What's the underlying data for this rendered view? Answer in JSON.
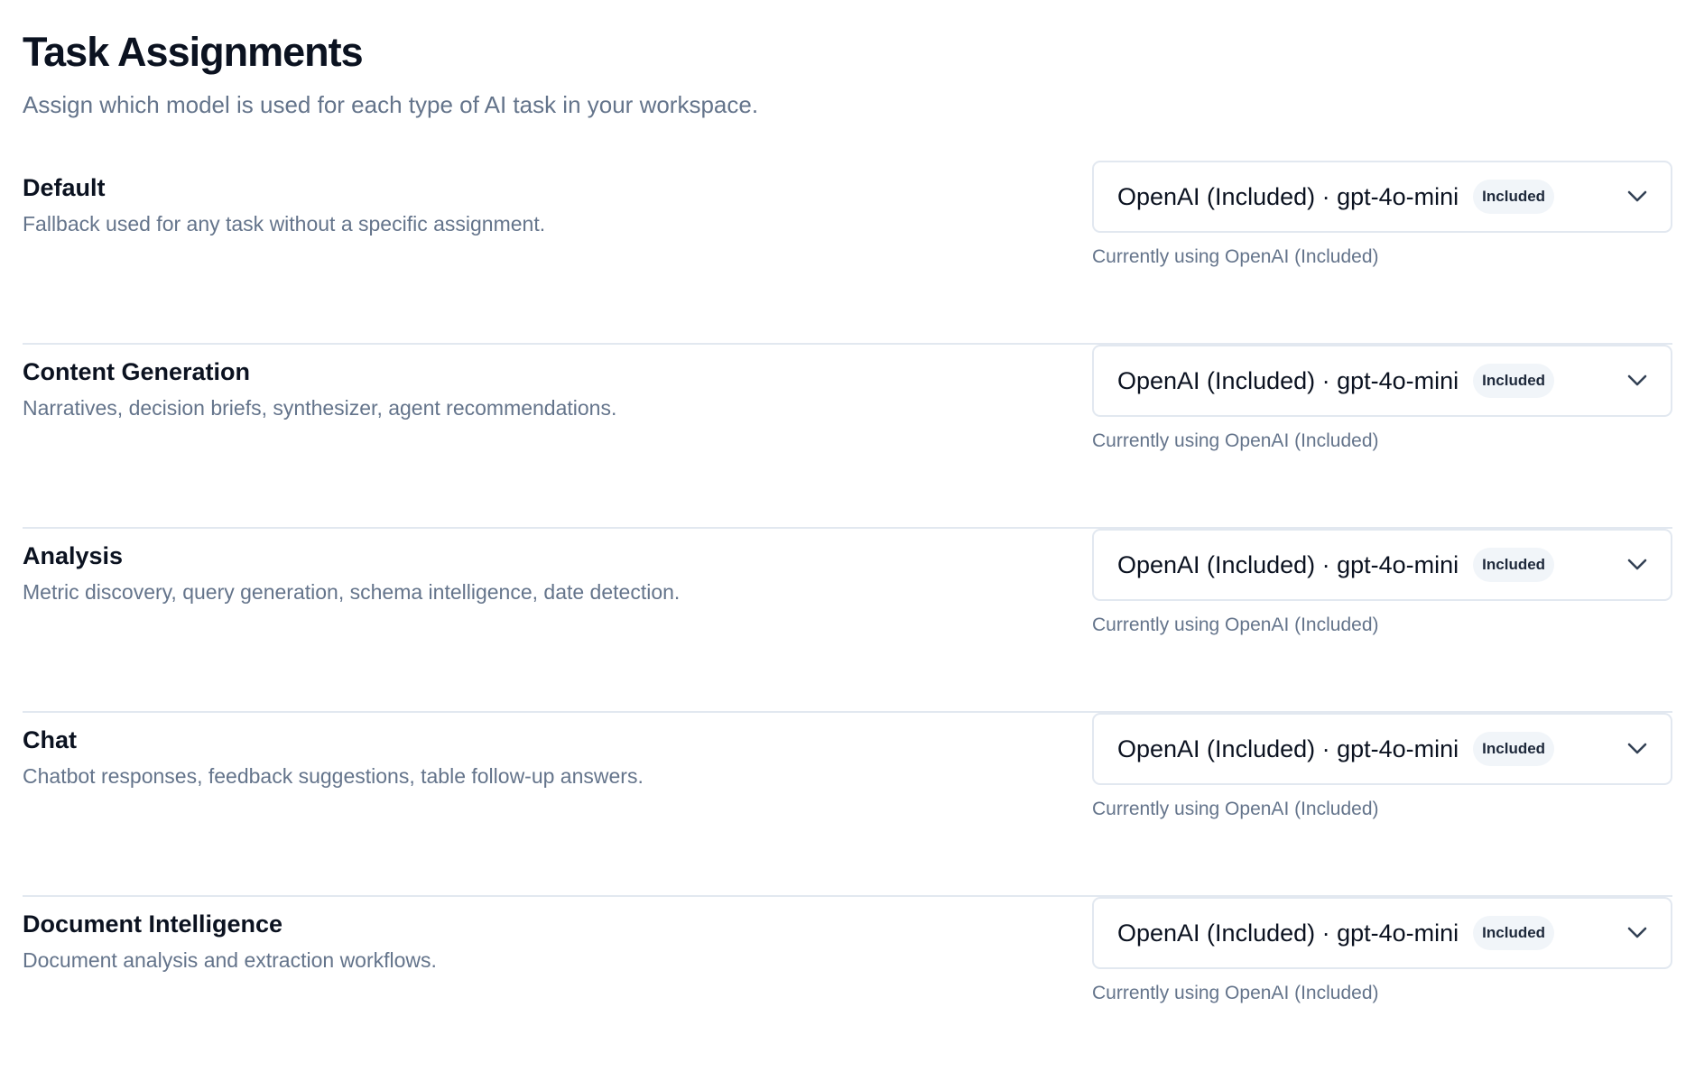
{
  "header": {
    "title": "Task Assignments",
    "subtitle": "Assign which model is used for each type of AI task in your workspace."
  },
  "tasks": [
    {
      "name": "Default",
      "description": "Fallback used for any task without a specific assignment.",
      "selected": "OpenAI (Included) · gpt-4o-mini",
      "badge": "Included",
      "helper": "Currently using OpenAI (Included)"
    },
    {
      "name": "Content Generation",
      "description": "Narratives, decision briefs, synthesizer, agent recommendations.",
      "selected": "OpenAI (Included) · gpt-4o-mini",
      "badge": "Included",
      "helper": "Currently using OpenAI (Included)"
    },
    {
      "name": "Analysis",
      "description": "Metric discovery, query generation, schema intelligence, date detection.",
      "selected": "OpenAI (Included) · gpt-4o-mini",
      "badge": "Included",
      "helper": "Currently using OpenAI (Included)"
    },
    {
      "name": "Chat",
      "description": "Chatbot responses, feedback suggestions, table follow-up answers.",
      "selected": "OpenAI (Included) · gpt-4o-mini",
      "badge": "Included",
      "helper": "Currently using OpenAI (Included)"
    },
    {
      "name": "Document Intelligence",
      "description": "Document analysis and extraction workflows.",
      "selected": "OpenAI (Included) · gpt-4o-mini",
      "badge": "Included",
      "helper": "Currently using OpenAI (Included)"
    }
  ],
  "icons": {
    "dropdown": "chevron-down-icon"
  },
  "colors": {
    "text_primary": "#0b1220",
    "text_muted": "#64748b",
    "border": "#e2e8f0",
    "badge_bg": "#f1f5f9"
  }
}
